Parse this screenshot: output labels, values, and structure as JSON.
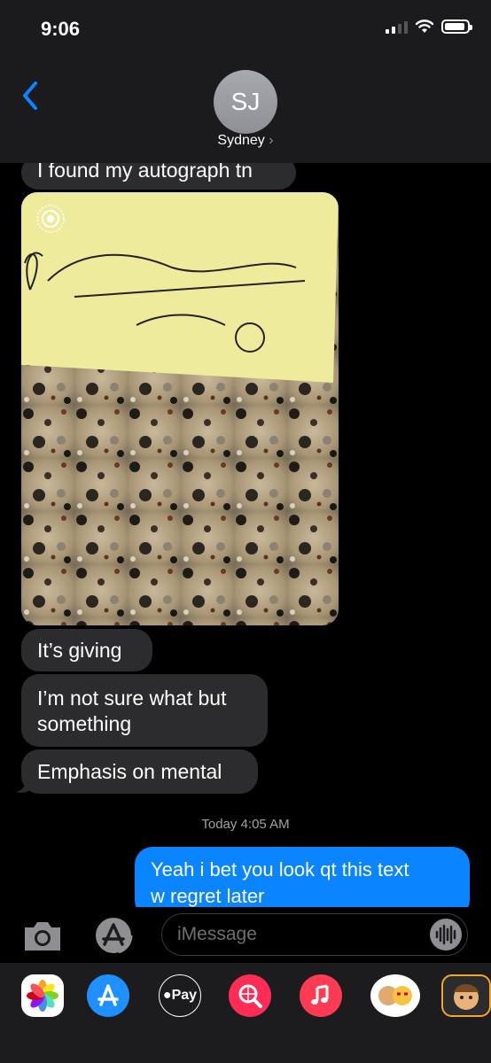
{
  "status_bar": {
    "time": "9:06"
  },
  "header": {
    "avatar_initials": "SJ",
    "contact_name": "Sydney",
    "chevron": "›"
  },
  "messages": {
    "autograph": "I found my autograph tn",
    "giving": "It’s giving",
    "not_sure_line1": "I’m not sure what but",
    "not_sure_line2": "something",
    "emphasis": "Emphasis on mental",
    "timestamp": "Today 4:05 AM",
    "outgoing_line1": "Yeah i bet you look qt this text",
    "outgoing_line2": "w regret later"
  },
  "input": {
    "placeholder": "iMessage"
  },
  "apps": [
    "photos-app",
    "app-store-app",
    "apple-pay-app",
    "images-search-app",
    "music-app",
    "memoji-stickers-app",
    "memoji-app"
  ],
  "apple_pay_label": "Pay",
  "colors": {
    "accent": "#0a84ff",
    "incoming_bubble": "#2c2c2e",
    "header_bg": "#1b1b1d"
  }
}
